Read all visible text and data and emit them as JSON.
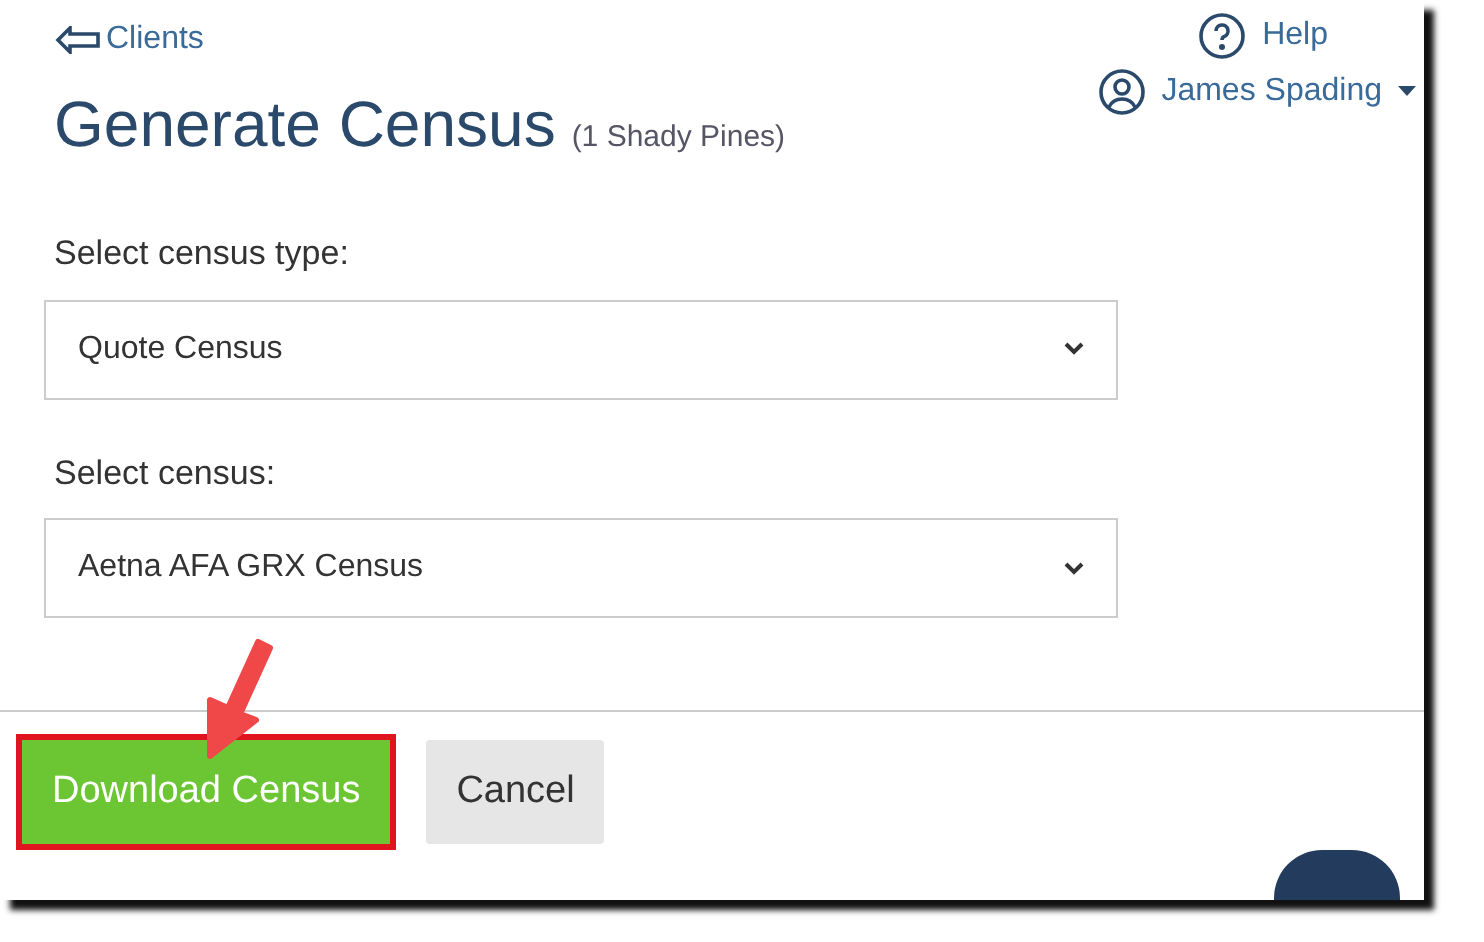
{
  "back_link": {
    "label": "Clients"
  },
  "title": "Generate Census",
  "subtitle": "(1 Shady Pines)",
  "help": {
    "label": "Help"
  },
  "user": {
    "name": "James Spading"
  },
  "fields": [
    {
      "label": "Select census type:",
      "value": "Quote Census"
    },
    {
      "label": "Select census:",
      "value": "Aetna AFA GRX Census"
    }
  ],
  "buttons": [
    {
      "label": "Download Census",
      "kind": "primary",
      "highlighted": true
    },
    {
      "label": "Cancel",
      "kind": "secondary",
      "highlighted": false
    }
  ]
}
